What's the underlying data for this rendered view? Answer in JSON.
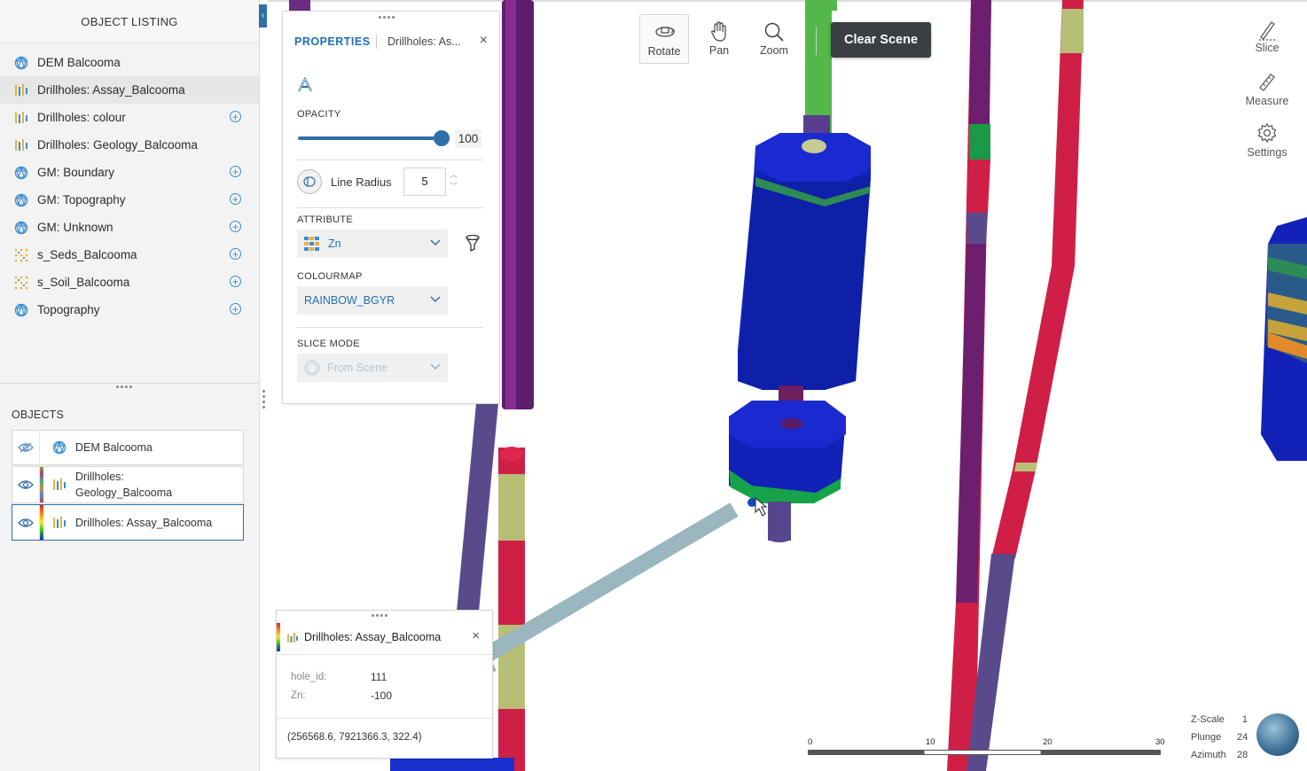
{
  "listing": {
    "title": "OBJECT LISTING",
    "items": [
      {
        "label": "DEM Balcooma",
        "icon": "surface-icon",
        "add": false,
        "selected": false
      },
      {
        "label": "Drillholes: Assay_Balcooma",
        "icon": "drillhole-icon",
        "add": false,
        "selected": true
      },
      {
        "label": "Drillholes: colour",
        "icon": "drillhole-icon",
        "add": true,
        "selected": false
      },
      {
        "label": "Drillholes: Geology_Balcooma",
        "icon": "drillhole-icon",
        "add": false,
        "selected": false
      },
      {
        "label": "GM: Boundary",
        "icon": "surface-icon",
        "add": true,
        "selected": false
      },
      {
        "label": "GM: Topography",
        "icon": "surface-icon",
        "add": true,
        "selected": false
      },
      {
        "label": "GM: Unknown",
        "icon": "surface-icon",
        "add": true,
        "selected": false
      },
      {
        "label": "s_Seds_Balcooma",
        "icon": "points-icon",
        "add": true,
        "selected": false
      },
      {
        "label": "s_Soil_Balcooma",
        "icon": "points-icon",
        "add": true,
        "selected": false
      },
      {
        "label": "Topography",
        "icon": "surface-icon",
        "add": true,
        "selected": false
      }
    ]
  },
  "objects": {
    "title": "OBJECTS",
    "items": [
      {
        "label": "DEM Balcooma",
        "icon": "surface-icon"
      },
      {
        "label": "Drillholes: Geology_Balcooma",
        "label_line1": "Drillholes:",
        "label_line2": "Geology_Balcooma",
        "icon": "drillhole-icon"
      },
      {
        "label": "Drillholes: Assay_Balcooma",
        "icon": "drillhole-icon"
      }
    ]
  },
  "properties": {
    "tab_label": "PROPERTIES",
    "object_tab": "Drillholes: As...",
    "opacity_label": "OPACITY",
    "opacity_value": "100",
    "opacity_fraction": 1.0,
    "line_radius_label": "Line Radius",
    "line_radius_value": "5",
    "attribute_label": "ATTRIBUTE",
    "attribute_value": "Zn",
    "colourmap_label": "COLOURMAP",
    "colourmap_value": "RAINBOW_BGYR",
    "slice_mode_label": "SLICE MODE",
    "slice_mode_value": "From Scene"
  },
  "toolbar": {
    "rotate": "Rotate",
    "pan": "Pan",
    "zoom": "Zoom",
    "clear_scene": "Clear Scene",
    "slice": "Slice",
    "measure": "Measure",
    "settings": "Settings"
  },
  "info": {
    "title": "Drillholes: Assay_Balcooma",
    "hole_id_key": "hole_id:",
    "hole_id_value": "111",
    "zn_key": "Zn:",
    "zn_value": "-100",
    "coords": "(256568.6, 7921366.3, 322.4)"
  },
  "scale": {
    "ticks": [
      "0",
      "10",
      "20",
      "30"
    ]
  },
  "nav": {
    "zscale_label": "Z-Scale",
    "zscale_value": "1",
    "plunge_label": "Plunge",
    "plunge_value": "24",
    "azimuth_label": "Azimuth",
    "azimuth_value": "28"
  },
  "colors": {
    "accent": "#2e6fa8",
    "tab_blue": "#1f6fb5",
    "clear_button": "#3a3f44",
    "arrow": "#9ab6bf"
  }
}
